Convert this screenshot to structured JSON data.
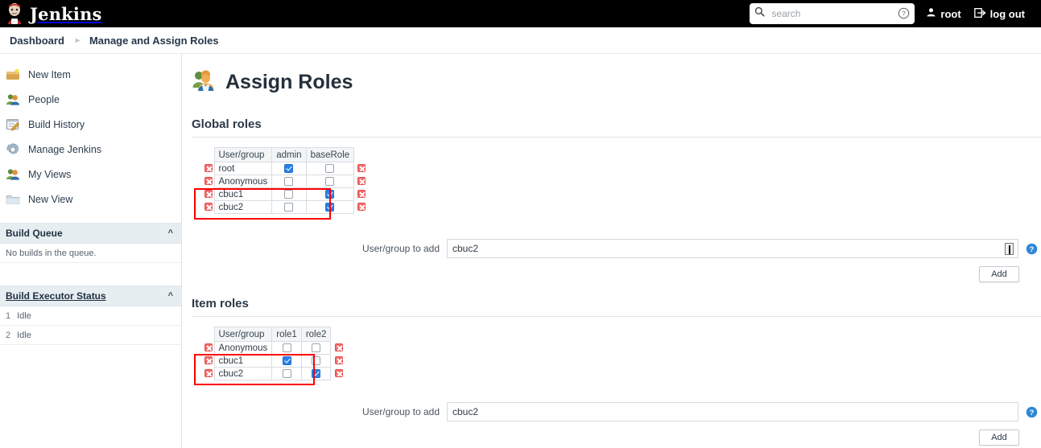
{
  "topbar": {
    "brand": "Jenkins",
    "brand_icon": "jenkins-butler-logo",
    "search": {
      "placeholder": "search",
      "value": "",
      "icon": "search-icon",
      "help_icon": "help-circle-icon"
    },
    "user": {
      "label": "root",
      "icon": "person-icon"
    },
    "logout": {
      "label": "log out",
      "icon": "logout-arrow-icon"
    },
    "background": "#000000"
  },
  "breadcrumb": {
    "items": [
      "Dashboard",
      "Manage and Assign Roles"
    ],
    "separator": "▸"
  },
  "sidebar": {
    "items": [
      {
        "label": "New Item",
        "icon": "new-item-icon"
      },
      {
        "label": "People",
        "icon": "people-icon"
      },
      {
        "label": "Build History",
        "icon": "build-history-icon"
      },
      {
        "label": "Manage Jenkins",
        "icon": "gear-icon"
      },
      {
        "label": "My Views",
        "icon": "my-views-icon"
      },
      {
        "label": "New View",
        "icon": "folder-icon"
      }
    ],
    "build_queue": {
      "title": "Build Queue",
      "collapse_icon": "chevron-up-icon",
      "empty_text": "No builds in the queue."
    },
    "build_executor_status": {
      "title": "Build Executor Status",
      "collapse_icon": "chevron-up-icon",
      "executors": [
        {
          "num": "1",
          "status": "Idle"
        },
        {
          "num": "2",
          "status": "Idle"
        }
      ]
    }
  },
  "main": {
    "page_title": "Assign Roles",
    "page_icon": "assign-roles-group-icon",
    "global_roles": {
      "heading": "Global roles",
      "columns": [
        "User/group",
        "admin",
        "baseRole"
      ],
      "rows": [
        {
          "name": "root",
          "checks": [
            true,
            false
          ],
          "delete_icon": "delete-icon"
        },
        {
          "name": "Anonymous",
          "checks": [
            false,
            false
          ],
          "delete_icon": "delete-icon"
        },
        {
          "name": "cbuc1",
          "checks": [
            false,
            true
          ],
          "delete_icon": "delete-icon"
        },
        {
          "name": "cbuc2",
          "checks": [
            false,
            true
          ],
          "delete_icon": "delete-icon"
        }
      ],
      "highlight_rows": [
        2,
        3
      ],
      "highlight_color": "#ff0000",
      "add": {
        "label": "User/group to add",
        "value": "cbuc2",
        "placeholder": "",
        "has_caret_icon": true,
        "help_icon": "help-icon",
        "button": "Add"
      }
    },
    "item_roles": {
      "heading": "Item roles",
      "columns": [
        "User/group",
        "role1",
        "role2"
      ],
      "rows": [
        {
          "name": "Anonymous",
          "checks": [
            false,
            false
          ],
          "delete_icon": "delete-icon"
        },
        {
          "name": "cbuc1",
          "checks": [
            true,
            false
          ],
          "delete_icon": "delete-icon"
        },
        {
          "name": "cbuc2",
          "checks": [
            false,
            true
          ],
          "delete_icon": "delete-icon"
        }
      ],
      "highlight_rows": [
        1,
        2
      ],
      "highlight_color": "#ff0000",
      "add": {
        "label": "User/group to add",
        "value": "cbuc2",
        "placeholder": "",
        "has_caret_icon": false,
        "help_icon": "help-icon",
        "button": "Add"
      }
    }
  }
}
